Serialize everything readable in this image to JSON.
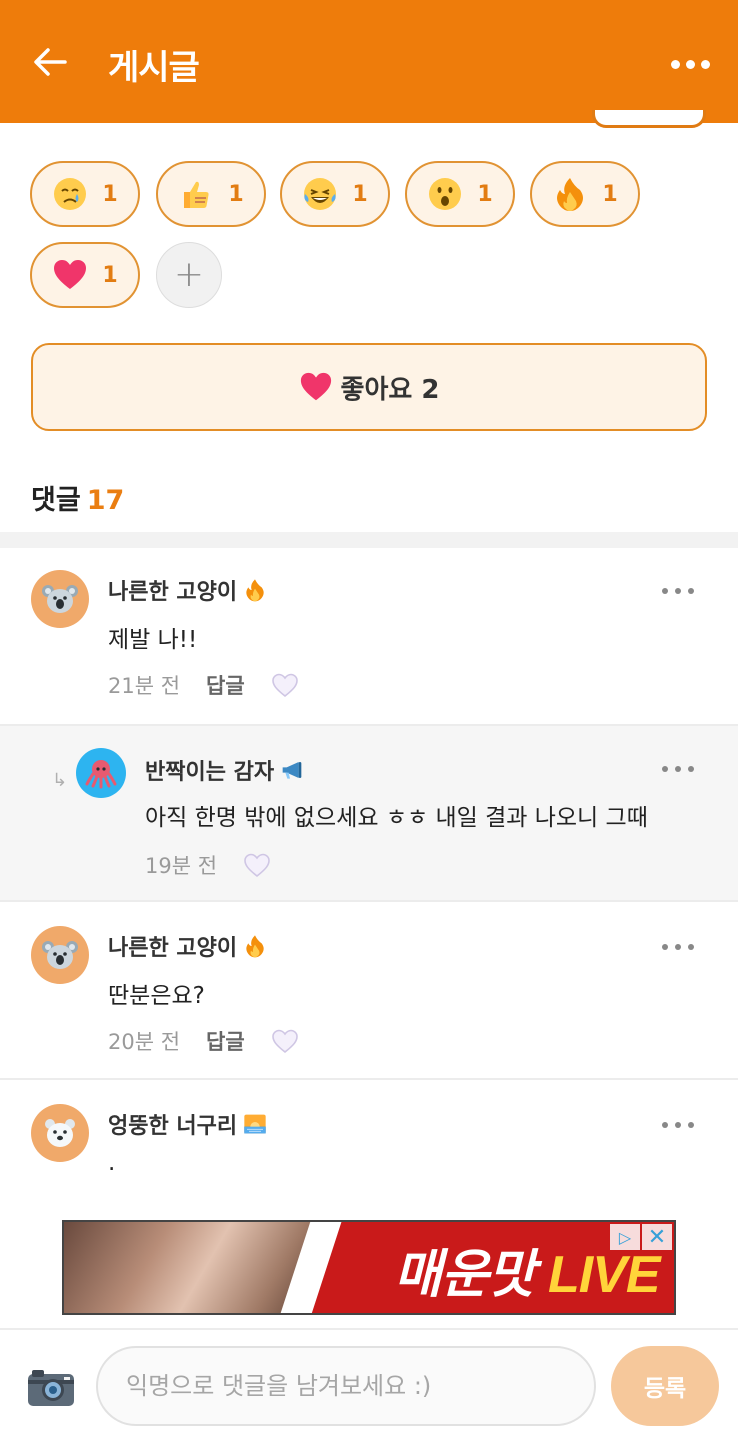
{
  "header": {
    "title": "게시글",
    "back_icon": "arrow-left-icon",
    "more_icon": "more-horizontal-icon",
    "background": "#ee7c0b"
  },
  "reactions": [
    {
      "emoji": "crying-face",
      "count": "1"
    },
    {
      "emoji": "thumbs-up",
      "count": "1"
    },
    {
      "emoji": "tears-of-joy",
      "count": "1"
    },
    {
      "emoji": "surprised-face",
      "count": "1"
    },
    {
      "emoji": "fire",
      "count": "1"
    },
    {
      "emoji": "red-heart",
      "count": "1"
    }
  ],
  "add_reaction_label": "+",
  "like_button": {
    "label": "좋아요 2",
    "icon": "heart-icon"
  },
  "comments_section": {
    "title": "댓글",
    "count": "17"
  },
  "comments": [
    {
      "nickname": "나른한 고양이",
      "badge": "fire-badge",
      "text": "제발 나!!",
      "time": "21분 전",
      "reply_label": "답글",
      "avatar": "koala"
    },
    {
      "nickname": "반짝이는 감자",
      "badge": "megaphone-badge",
      "text": "아직 한명 밖에 없으세요 ㅎㅎ 내일 결과 나오니 그때",
      "time": "19분 전",
      "avatar": "octopus",
      "is_reply": true
    },
    {
      "nickname": "나른한 고양이",
      "badge": "fire-badge",
      "text": "딴분은요?",
      "time": "20분 전",
      "reply_label": "답글",
      "avatar": "koala"
    },
    {
      "nickname": "엉뚱한 너구리",
      "badge": "sunrise-badge",
      "text": ".",
      "avatar": "polar-bear"
    }
  ],
  "ad": {
    "title_main": "매운맛",
    "title_accent": "LIVE",
    "close": "✕",
    "adchoice": "▷"
  },
  "bottom_bar": {
    "placeholder": "익명으로 댓글을 남겨보세요 :)",
    "submit_label": "등록",
    "camera_icon": "camera-icon"
  }
}
